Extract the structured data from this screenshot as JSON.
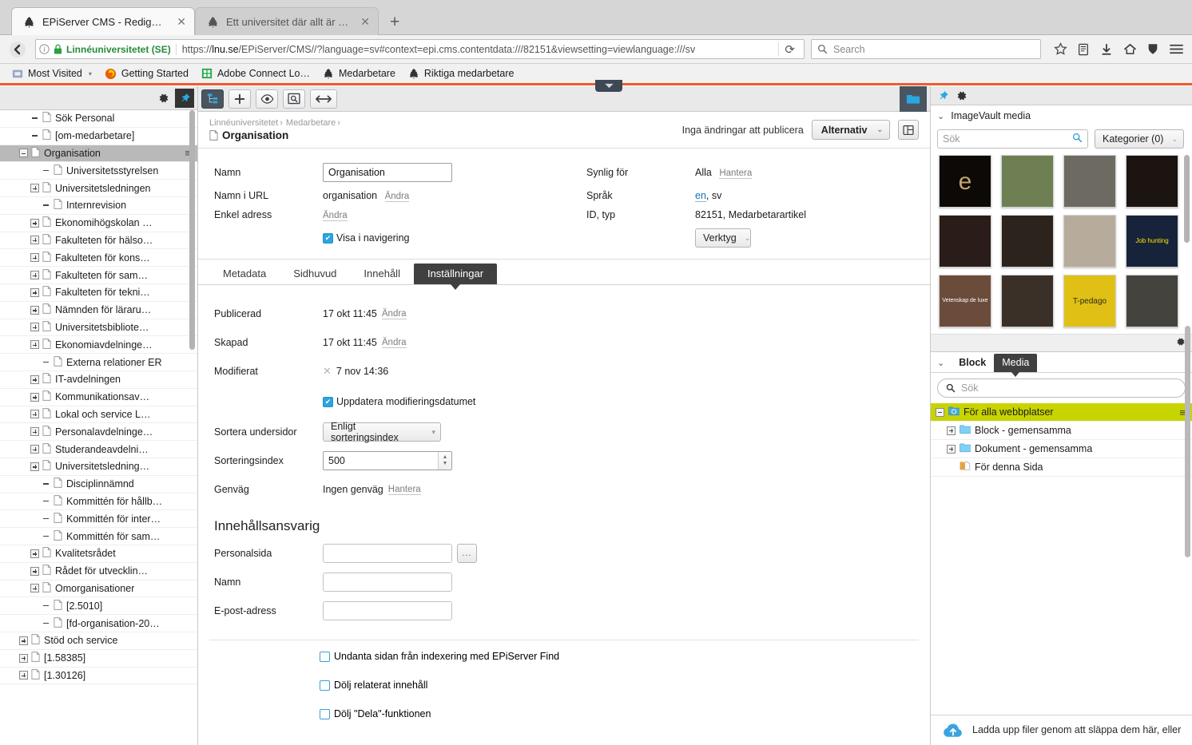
{
  "browser": {
    "tabs": [
      {
        "title": "EPiServer CMS - Redigera",
        "active": true,
        "close": "✕"
      },
      {
        "title": "Ett universitet där allt är m…",
        "active": false,
        "close": "✕"
      }
    ],
    "newtab_label": "+",
    "identity": "Linnéuniversitetet (SE)",
    "url_host": "lnu.se",
    "url_prefix": "https://",
    "url_rest": "/EPiServer/CMS//?language=sv#context=epi.cms.contentdata:///82151&viewsetting=viewlanguage:///sv",
    "search_placeholder": "Search",
    "bookmarks": [
      {
        "label": "Most Visited",
        "icon": "folder-icon",
        "caret": "▾"
      },
      {
        "label": "Getting Started",
        "icon": "firefox-icon"
      },
      {
        "label": "Adobe Connect Lo…",
        "icon": "adobe-connect-icon"
      },
      {
        "label": "Medarbetare",
        "icon": "lnu-tree-icon"
      },
      {
        "label": "Riktiga medarbetare",
        "icon": "lnu-tree-icon"
      }
    ]
  },
  "left_pane": {
    "tree": [
      {
        "label": "Sök Personal",
        "indent": 2,
        "expander": "none"
      },
      {
        "label": "[om-medarbetare]",
        "indent": 2,
        "expander": "none"
      },
      {
        "label": "Organisation",
        "indent": 1,
        "expander": "minus",
        "selected": true,
        "menu": "≡"
      },
      {
        "label": "Universitetsstyrelsen",
        "indent": 3,
        "expander": "none"
      },
      {
        "label": "Universitetsledningen",
        "indent": 2,
        "expander": "plus"
      },
      {
        "label": "Internrevision",
        "indent": 3,
        "expander": "none"
      },
      {
        "label": "Ekonomihögskolan …",
        "indent": 2,
        "expander": "plus"
      },
      {
        "label": "Fakulteten för hälso…",
        "indent": 2,
        "expander": "plus"
      },
      {
        "label": "Fakulteten för kons…",
        "indent": 2,
        "expander": "plus"
      },
      {
        "label": "Fakulteten för sam…",
        "indent": 2,
        "expander": "plus"
      },
      {
        "label": "Fakulteten för tekni…",
        "indent": 2,
        "expander": "plus"
      },
      {
        "label": "Nämnden för läraru…",
        "indent": 2,
        "expander": "plus"
      },
      {
        "label": "Universitetsbibliote…",
        "indent": 2,
        "expander": "plus"
      },
      {
        "label": "Ekonomiavdelninge…",
        "indent": 2,
        "expander": "plus"
      },
      {
        "label": "Externa relationer ER",
        "indent": 3,
        "expander": "none"
      },
      {
        "label": "IT-avdelningen",
        "indent": 2,
        "expander": "plus"
      },
      {
        "label": "Kommunikationsav…",
        "indent": 2,
        "expander": "plus"
      },
      {
        "label": "Lokal och service L…",
        "indent": 2,
        "expander": "plus"
      },
      {
        "label": "Personalavdelninge…",
        "indent": 2,
        "expander": "plus"
      },
      {
        "label": "Studerandeavdelni…",
        "indent": 2,
        "expander": "plus"
      },
      {
        "label": "Universitetsledning…",
        "indent": 2,
        "expander": "plus"
      },
      {
        "label": "Disciplinnämnd",
        "indent": 3,
        "expander": "none"
      },
      {
        "label": "Kommittén för hållb…",
        "indent": 3,
        "expander": "none"
      },
      {
        "label": "Kommittén för inter…",
        "indent": 3,
        "expander": "none"
      },
      {
        "label": "Kommittén för sam…",
        "indent": 3,
        "expander": "none"
      },
      {
        "label": "Kvalitetsrådet",
        "indent": 2,
        "expander": "plus"
      },
      {
        "label": "Rådet för utvecklin…",
        "indent": 2,
        "expander": "plus"
      },
      {
        "label": "Omorganisationer",
        "indent": 2,
        "expander": "plus"
      },
      {
        "label": "[2.5010]",
        "indent": 3,
        "expander": "none"
      },
      {
        "label": "[fd-organisation-20…",
        "indent": 3,
        "expander": "none"
      },
      {
        "label": "Stöd och service",
        "indent": 1,
        "expander": "plus"
      },
      {
        "label": "[1.58385]",
        "indent": 1,
        "expander": "plus"
      },
      {
        "label": "[1.30126]",
        "indent": 1,
        "expander": "plus"
      }
    ]
  },
  "toolbar": {
    "buttons": [
      {
        "name": "page-tree-toggle",
        "glyph": "structure-icon",
        "active": true
      },
      {
        "name": "create-new",
        "glyph": "plus-icon"
      },
      {
        "name": "preview",
        "glyph": "eye-icon"
      },
      {
        "name": "view-on-site",
        "glyph": "magnify-page-icon"
      },
      {
        "name": "toggle-width",
        "glyph": "arrows-icon"
      }
    ],
    "assets_toggle": "folder-icon"
  },
  "header": {
    "breadcrumb_root": "Linnéuniversitetet",
    "breadcrumb_sep": "›",
    "breadcrumb_parent": "Medarbetare",
    "page_title": "Organisation",
    "publish_status": "Inga ändringar att publicera",
    "options_label": "Alternativ",
    "options_caret": "⌄",
    "view_toggle": "layout-icon"
  },
  "properties": {
    "namn_label": "Namn",
    "namn_value": "Organisation",
    "namn_url_label": "Namn i URL",
    "namn_url_value": "organisation",
    "namn_url_action": "Ändra",
    "enkel_adress_label": "Enkel adress",
    "enkel_adress_action": "Ändra",
    "visa_i_navigering": "Visa i navigering",
    "synlig_label": "Synlig för",
    "synlig_value": "Alla",
    "synlig_action": "Hantera",
    "sprak_label": "Språk",
    "sprak_primary": "en",
    "sprak_rest": ", sv",
    "id_label": "ID, typ",
    "id_value": "82151, Medarbetarartikel",
    "verktyg_label": "Verktyg",
    "verktyg_caret": "⌄"
  },
  "form_tabs": [
    {
      "label": "Metadata",
      "active": false
    },
    {
      "label": "Sidhuvud",
      "active": false
    },
    {
      "label": "Innehåll",
      "active": false
    },
    {
      "label": "Inställningar",
      "active": true
    }
  ],
  "settings": {
    "publicerad_label": "Publicerad",
    "publicerad_value": "17 okt 11:45",
    "publicerad_action": "Ändra",
    "skapad_label": "Skapad",
    "skapad_value": "17 okt 11:45",
    "skapad_action": "Ändra",
    "modifierat_label": "Modifierat",
    "modifierat_value": "7 nov 14:36",
    "modifierat_clear": "✕",
    "uppdatera_label": "Uppdatera modifieringsdatumet",
    "sortera_label": "Sortera undersidor",
    "sortera_value": "Enligt sorteringsindex",
    "sortera_caret": "▾",
    "sorteringsindex_label": "Sorteringsindex",
    "sorteringsindex_value": "500",
    "genvag_label": "Genväg",
    "genvag_value": "Ingen genväg",
    "genvag_action": "Hantera"
  },
  "content_owner": {
    "section_title": "Innehållsansvarig",
    "personalsida_label": "Personalsida",
    "personalsida_value": "",
    "browse_label": "...",
    "namn_label": "Namn",
    "namn_value": "",
    "epost_label": "E-post-adress",
    "epost_value": "",
    "checkboxes": [
      {
        "label": "Undanta sidan från indexering med EPiServer Find",
        "checked": false
      },
      {
        "label": "Dölj relaterat innehåll",
        "checked": false
      },
      {
        "label": "Dölj \"Dela\"-funktionen",
        "checked": false
      }
    ]
  },
  "right_pane": {
    "imagevault": {
      "title": "ImageVault media",
      "chevron": "⌄",
      "search_placeholder": "Sök",
      "search_icon": "magnifier-icon",
      "categories_label": "Kategorier (0)",
      "categories_caret": "⌄",
      "thumbs": [
        {
          "alt": "e",
          "bg": "#0d0906",
          "label": "e",
          "color": "#c6a46a",
          "size": "30px"
        },
        {
          "alt": "path landscape",
          "bg": "#6f7f54",
          "label": "",
          "color": "#fff",
          "size": "9px"
        },
        {
          "alt": "group photo",
          "bg": "#6d6a62",
          "label": "",
          "color": "#fff",
          "size": "9px"
        },
        {
          "alt": "orchestra conductor",
          "bg": "#1b1410",
          "label": "",
          "color": "#fff",
          "size": "9px"
        },
        {
          "alt": "woman portrait",
          "bg": "#2a1c18",
          "label": "",
          "color": "#fff",
          "size": "9px"
        },
        {
          "alt": "lamp interior",
          "bg": "#2b231c",
          "label": "",
          "color": "#fff",
          "size": "9px"
        },
        {
          "alt": "sheet music",
          "bg": "#b7ac9b",
          "label": "",
          "color": "#333",
          "size": "9px"
        },
        {
          "alt": "Job hunting Career Night poster",
          "bg": "#16233a",
          "label": "Job hunting",
          "color": "#ffe400",
          "size": "8px"
        },
        {
          "alt": "Vetenskap de luxe book",
          "bg": "#6b4c3a",
          "label": "Vetenskap de luxe",
          "color": "#fff",
          "size": "7px"
        },
        {
          "alt": "group of students",
          "bg": "#3a3028",
          "label": "",
          "color": "#fff",
          "size": "9px"
        },
        {
          "alt": "IT-pedagog yellow cover",
          "bg": "#e0c014",
          "label": "T-pedago",
          "color": "#2a2a1a",
          "size": "10px"
        },
        {
          "alt": "man portrait",
          "bg": "#45433d",
          "label": "",
          "color": "#fff",
          "size": "9px"
        }
      ],
      "settings_icon": "gear-icon"
    },
    "blockmedia": {
      "chevron": "⌄",
      "tabs": [
        {
          "label": "Block",
          "active": false
        },
        {
          "label": "Media",
          "active": true
        }
      ],
      "search_placeholder": "Sök",
      "search_icon": "magnifier-icon",
      "rows": [
        {
          "label": "För alla webbplatser",
          "indent": 0,
          "expander": "minus",
          "icon": "globe-folder-icon",
          "highlight": true,
          "menu": "≡"
        },
        {
          "label": "Block - gemensamma",
          "indent": 1,
          "expander": "plus",
          "icon": "folder-icon"
        },
        {
          "label": "Dokument - gemensamma",
          "indent": 1,
          "expander": "plus",
          "icon": "folder-icon"
        },
        {
          "label": "För denna Sida",
          "indent": 1,
          "expander": "none",
          "icon": "page-folder-icon"
        }
      ]
    },
    "dropzone": {
      "text": "Ladda upp filer genom att släppa dem här, eller",
      "icon": "upload-cloud-icon"
    },
    "pin_icon": "pin-icon",
    "gear_icon": "gear-icon"
  }
}
